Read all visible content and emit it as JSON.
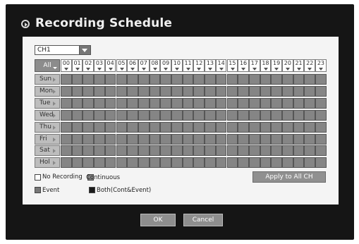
{
  "window": {
    "title": "Recording Schedule"
  },
  "channel_select": {
    "value": "CH1"
  },
  "grid": {
    "all_label": "All",
    "hours": [
      "00",
      "01",
      "02",
      "03",
      "04",
      "05",
      "06",
      "07",
      "08",
      "09",
      "10",
      "11",
      "12",
      "13",
      "14",
      "15",
      "16",
      "17",
      "18",
      "19",
      "20",
      "21",
      "22",
      "23"
    ],
    "days": [
      "Sun",
      "Mon",
      "Tue",
      "Wed",
      "Thu",
      "Fri",
      "Sat",
      "Hol"
    ]
  },
  "legend": {
    "no_recording": "No Recording",
    "continuous": "Continuous",
    "event": "Event",
    "both": "Both(Cont&Event)"
  },
  "colors": {
    "no_recording": "#ffffff",
    "continuous": "#858585",
    "event": "#777777",
    "both": "#1a1a1a"
  },
  "buttons": {
    "apply_all": "Apply to All CH",
    "ok": "OK",
    "cancel": "Cancel"
  }
}
